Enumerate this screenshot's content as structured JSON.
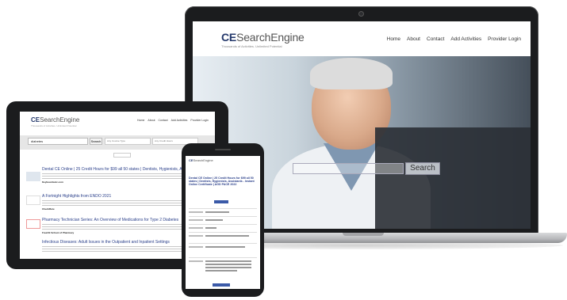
{
  "laptop": {
    "brand_bold": "CE",
    "brand_light": "SearchEngine",
    "tagline": "Thousands of Activities. Unlimited Potential",
    "nav": [
      "Home",
      "About",
      "Contact",
      "Add Activities",
      "Provider Login"
    ],
    "search_button": "Search"
  },
  "tablet": {
    "brand_bold": "CE",
    "brand_light": "SearchEngine",
    "tagline": "Thousands of Activities. Unlimited Potential",
    "nav": [
      "Home",
      "About",
      "Contact",
      "Add Activities",
      "Provider Login"
    ],
    "search_value": "diabetes",
    "search_button": "Search",
    "filter_1": "Any Course Type",
    "filter_2": "Any Credit Hours",
    "results": [
      {
        "title": "Dental CE Online | 25 Credit Hours for $99 all 50 states | Dentists, Hygienists, Assistants - Instant Online Certificate | AGD PACE 2022",
        "source": "Keyboardcetc.com"
      },
      {
        "title": "A Fortnight Highlights from ENDO 2021",
        "source": "CheckRare"
      },
      {
        "title": "Pharmacy Technician Series: An Overview of Medications for Type 2 Diabetes",
        "source": "FreeCE School of Pharmacy"
      },
      {
        "title": "Infectious Diseases: Adult Issues in the Outpatient and Inpatient Settings",
        "source": ""
      }
    ]
  },
  "phone": {
    "brand_bold": "CE",
    "brand_light": "SearchEngine",
    "title": "Dental CE Online | 25 Credit Hours for $99 all 50 states | Dentists, Hygienists, Assistants - Instant Online Certificate | AGD PACE 2022"
  }
}
